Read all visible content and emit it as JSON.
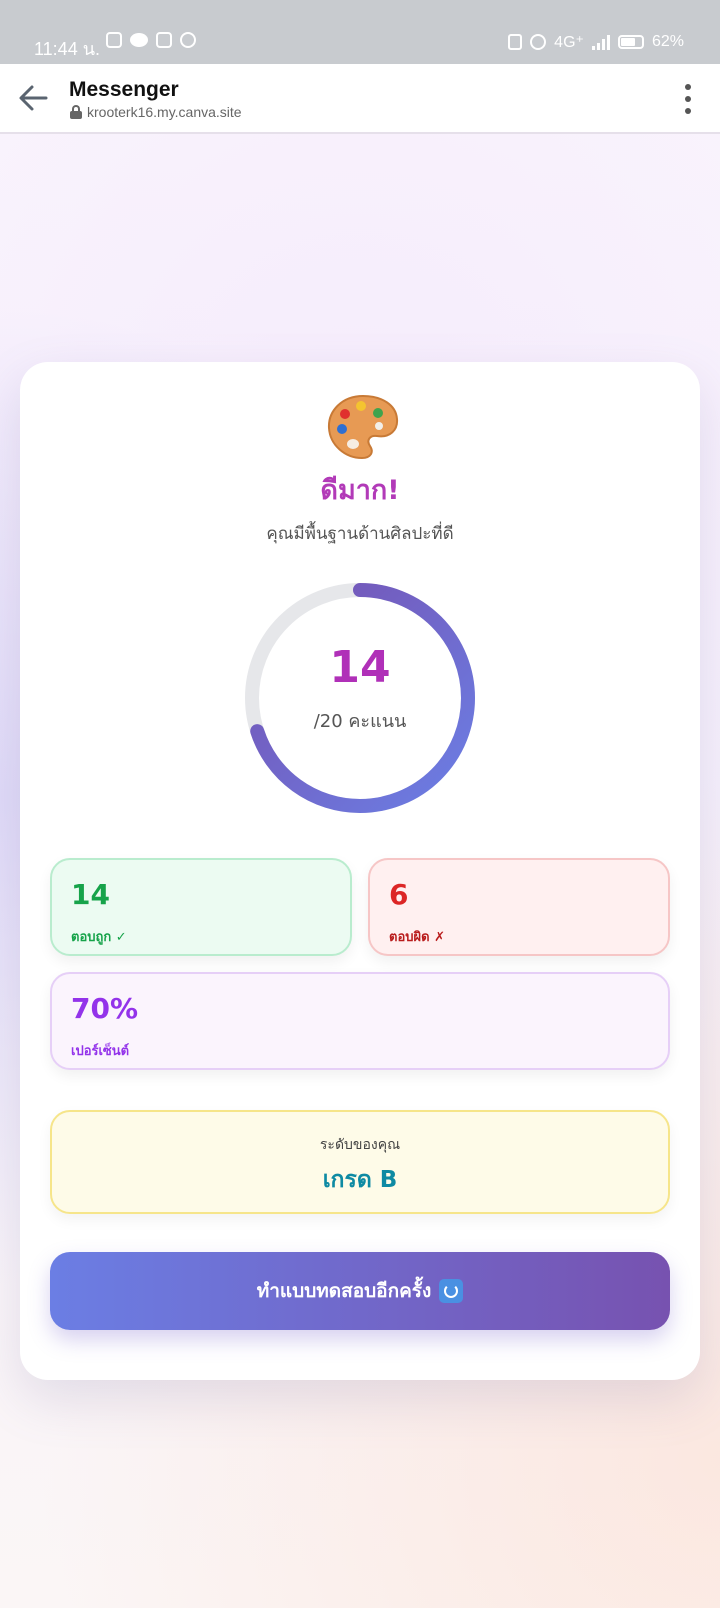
{
  "status_bar": {
    "time": "11:44 น.",
    "network": "4G⁺",
    "battery": "62%"
  },
  "browser": {
    "title": "Messenger",
    "url": "krooterk16.my.canva.site"
  },
  "result": {
    "icon": "art-palette-icon",
    "title": "ดีมาก!",
    "subtitle": "คุณมีพื้นฐานด้านศิลปะที่ดี",
    "score": "14",
    "score_total": "/20 คะแนน",
    "score_fraction": 0.7
  },
  "stats": {
    "correct_value": "14",
    "correct_label": "ตอบถูก ✓",
    "wrong_value": "6",
    "wrong_label": "ตอบผิด ✗",
    "percent_value": "70%",
    "percent_label": "เปอร์เซ็นต์"
  },
  "level": {
    "label": "ระดับของคุณ",
    "grade": "เกรด B"
  },
  "retry_button": {
    "label": "ทำแบบทดสอบอีกครั้ง"
  },
  "colors": {
    "accent_start": "#6b7ee4",
    "accent_end": "#7752b0",
    "title": "#b23ab8",
    "correct": "#16a34a",
    "wrong": "#dc2626",
    "percent": "#9333ea",
    "grade": "#0e8aa3"
  }
}
